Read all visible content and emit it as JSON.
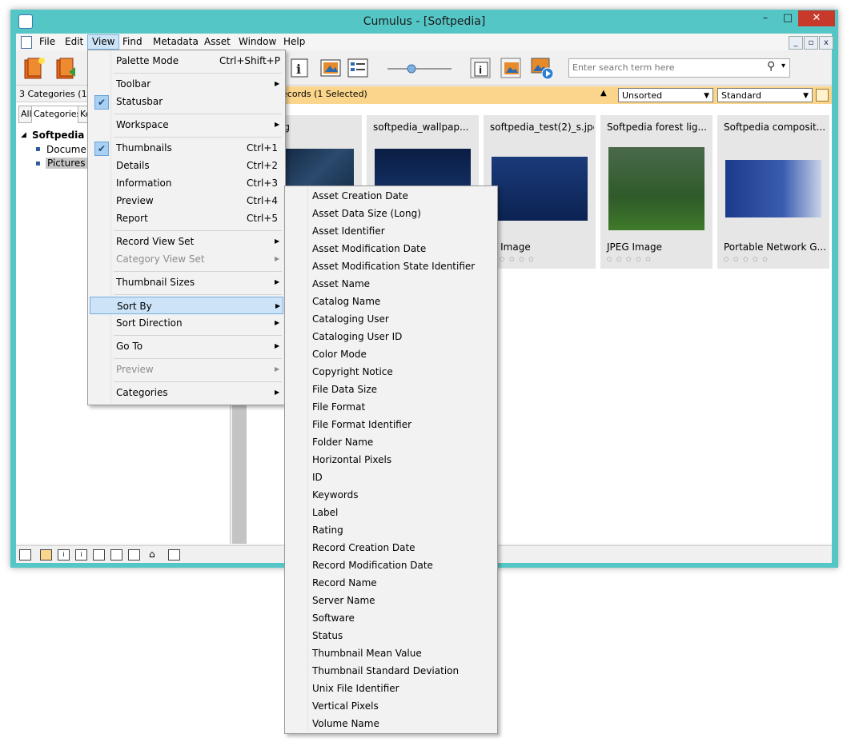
{
  "window": {
    "title": "Cumulus - [Softpedia]",
    "minimize": "–",
    "maximize": "□",
    "close": "✕"
  },
  "menubar": [
    "File",
    "Edit",
    "View",
    "Find",
    "Metadata",
    "Asset",
    "Window",
    "Help"
  ],
  "mdi": {
    "min": "_",
    "restore": "▫",
    "close": "x"
  },
  "search": {
    "placeholder": "Enter search term here"
  },
  "left": {
    "status": "3 Categories (1 Se",
    "tabs": [
      "All",
      "Categories",
      "Ke"
    ],
    "tree_root": "Softpedia",
    "tree_items": [
      "Documen",
      "Pictures"
    ]
  },
  "right": {
    "records_label": "ecords (1 Selected)",
    "sort_select": "Unsorted",
    "view_select": "Standard",
    "thumbnails": [
      {
        "name": "1-1.jpg",
        "type": "",
        "accent": "#13283f"
      },
      {
        "name": "softpedia_wallpap...",
        "type": "",
        "accent": "#0f2a55"
      },
      {
        "name": "softpedia_test(2)_s.jpg",
        "type": "G Image",
        "accent": "#1b3d7a"
      },
      {
        "name": "Softpedia forest lig...",
        "type": "JPEG Image",
        "accent": "#2f5a2a"
      },
      {
        "name": "Softpedia composit...",
        "type": "Portable Network G...",
        "accent": "#2a4a8f"
      }
    ],
    "rating_dots": "○○○○○"
  },
  "view_menu": {
    "items": [
      {
        "label": "Palette Mode",
        "shortcut": "Ctrl+Shift+P"
      },
      {
        "label": "Toolbar",
        "submenu": true
      },
      {
        "label": "Statusbar",
        "checked": true
      },
      {
        "label": "Workspace",
        "submenu": true
      },
      {
        "label": "Thumbnails",
        "shortcut": "Ctrl+1",
        "checked": true
      },
      {
        "label": "Details",
        "shortcut": "Ctrl+2"
      },
      {
        "label": "Information",
        "shortcut": "Ctrl+3"
      },
      {
        "label": "Preview",
        "shortcut": "Ctrl+4"
      },
      {
        "label": "Report",
        "shortcut": "Ctrl+5"
      },
      {
        "label": "Record View Set",
        "submenu": true
      },
      {
        "label": "Category View Set",
        "submenu": true,
        "disabled": true
      },
      {
        "label": "Thumbnail Sizes",
        "submenu": true
      },
      {
        "label": "Sort By",
        "submenu": true,
        "highlighted": true
      },
      {
        "label": "Sort Direction",
        "submenu": true
      },
      {
        "label": "Go To",
        "submenu": true
      },
      {
        "label": "Preview",
        "submenu": true,
        "disabled": true
      },
      {
        "label": "Categories",
        "submenu": true
      }
    ]
  },
  "sort_by_menu": [
    "Asset Creation Date",
    "Asset Data Size (Long)",
    "Asset Identifier",
    "Asset Modification Date",
    "Asset Modification State Identifier",
    "Asset Name",
    "Catalog Name",
    "Cataloging User",
    "Cataloging User ID",
    "Color Mode",
    "Copyright Notice",
    "File Data Size",
    "File Format",
    "File Format Identifier",
    "Folder Name",
    "Horizontal Pixels",
    "ID",
    "Keywords",
    "Label",
    "Rating",
    "Record Creation Date",
    "Record Modification Date",
    "Record Name",
    "Server Name",
    "Software",
    "Status",
    "Thumbnail Mean Value",
    "Thumbnail Standard Deviation",
    "Unix File Identifier",
    "Vertical Pixels",
    "Volume Name"
  ],
  "glyphs": {
    "check": "✔",
    "arrow": "▶",
    "search": "⚲",
    "caret": "▾",
    "tree_toggle": "◢",
    "bullet": "▪"
  }
}
